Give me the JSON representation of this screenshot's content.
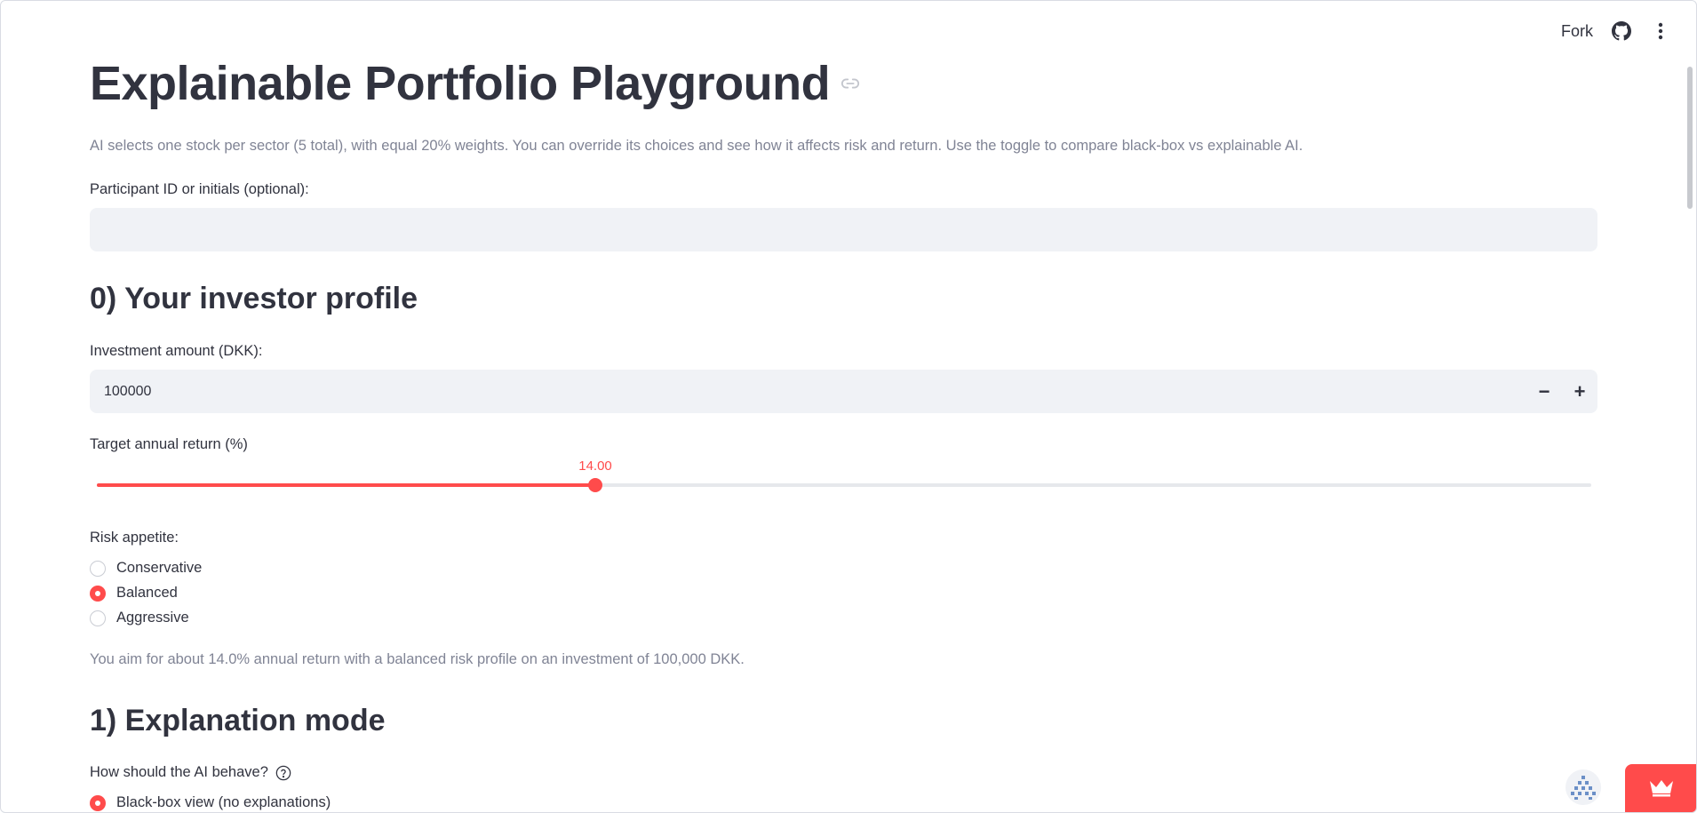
{
  "toolbar": {
    "fork_label": "Fork"
  },
  "page": {
    "title": "Explainable Portfolio Playground",
    "caption": "AI selects one stock per sector (5 total), with equal 20% weights. You can override its choices and see how it affects risk and return. Use the toggle to compare black-box vs explainable AI."
  },
  "participant": {
    "label": "Participant ID or initials (optional):",
    "value": ""
  },
  "profile": {
    "heading": "0) Your investor profile",
    "amount_label": "Investment amount (DKK):",
    "amount_value": "100000",
    "decrement": "−",
    "increment": "+",
    "target_label": "Target annual return (%)",
    "target_value": "14.00",
    "target_fraction": 0.3333,
    "risk_label": "Risk appetite:",
    "risk_options": [
      "Conservative",
      "Balanced",
      "Aggressive"
    ],
    "risk_selected": "Balanced",
    "summary": "You aim for about 14.0% annual return with a balanced risk profile on an investment of 100,000 DKK."
  },
  "explanation": {
    "heading": "1) Explanation mode",
    "question": "How should the AI behave?",
    "option_first": "Black-box view (no explanations)"
  },
  "colors": {
    "accent": "#ff4b4b",
    "text": "#31333f",
    "muted": "#808495",
    "input_bg": "#f0f2f6"
  },
  "icons": {
    "toolbar": [
      "github-icon",
      "more-vertical-icon"
    ],
    "title_anchor": "link-icon",
    "help": "help-circle-icon",
    "bottom": [
      "streamlit-logo-icon",
      "crown-icon"
    ]
  }
}
